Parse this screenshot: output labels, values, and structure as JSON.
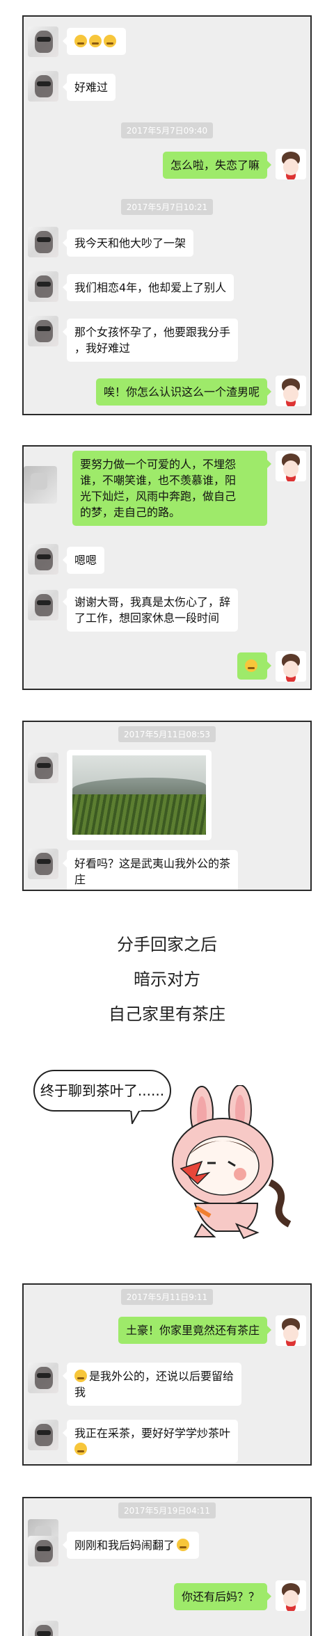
{
  "panel1": {
    "messages": [
      {
        "side": "left",
        "text": "😣😣😣"
      },
      {
        "side": "left",
        "text": "好难过"
      },
      {
        "type": "timestamp",
        "text": "2017年5月7日09:40"
      },
      {
        "side": "right",
        "text": "怎么啦，失恋了嘛"
      },
      {
        "type": "timestamp",
        "text": "2017年5月7日10:21"
      },
      {
        "side": "left",
        "text": "我今天和他大吵了一架"
      },
      {
        "side": "left",
        "text": "我们相恋4年，他却爱上了别人"
      },
      {
        "side": "left",
        "line1": "那个女孩怀孕了，他要跟我分手",
        "line2": "，我好难过"
      },
      {
        "side": "right",
        "text": "唉！你怎么认识这么一个渣男呢"
      }
    ]
  },
  "panel2": {
    "messages": [
      {
        "side": "right",
        "lines": [
          "要努力做一个可爱的人，不埋怨",
          "谁，不嘲笑谁，也不羡慕谁，阳",
          "光下灿烂，风雨中奔跑，做自己",
          "的梦，走自己的路。"
        ]
      },
      {
        "side": "left",
        "text": "嗯嗯"
      },
      {
        "side": "left",
        "lines": [
          "谢谢大哥，我真是太伤心了，辞",
          "了工作，想回家休息一段时间"
        ]
      },
      {
        "side": "right",
        "text": "😏"
      }
    ]
  },
  "panel3": {
    "timestamp": "2017年5月11日08:53",
    "messages": [
      {
        "side": "left",
        "type": "image",
        "icon": "tea-plantation-photo"
      },
      {
        "side": "left",
        "lines": [
          "好看吗？这是武夷山我外公的茶",
          "庄"
        ]
      }
    ]
  },
  "caption": {
    "line1": "分手回家之后",
    "line2": "暗示对方",
    "line3": "自己家里有茶庄"
  },
  "cartoon": {
    "speech": "终于聊到茶叶了......",
    "icon": "bunny-girl-cartoon"
  },
  "panel4": {
    "timestamp": "2017年5月11日9:11",
    "messages": [
      {
        "side": "right",
        "text": "土豪！你家里竟然还有茶庄"
      },
      {
        "side": "left",
        "lines": [
          "是我外公的，还说以后要留给",
          "我"
        ]
      },
      {
        "side": "left",
        "lines": [
          "我正在采茶，要好好学学炒茶叶",
          ""
        ]
      }
    ]
  },
  "panel5": {
    "timestamp": "2017年5月19日04:11",
    "messages": [
      {
        "side": "left",
        "text": "刚刚和我后妈闹翻了"
      },
      {
        "side": "right",
        "text": "你还有后妈？？"
      }
    ]
  },
  "colors": {
    "sent_bubble": "#9eea6a",
    "received_bubble": "#ffffff",
    "chat_background": "#eeeeee",
    "timestamp_chip": "#d6d6d6"
  }
}
